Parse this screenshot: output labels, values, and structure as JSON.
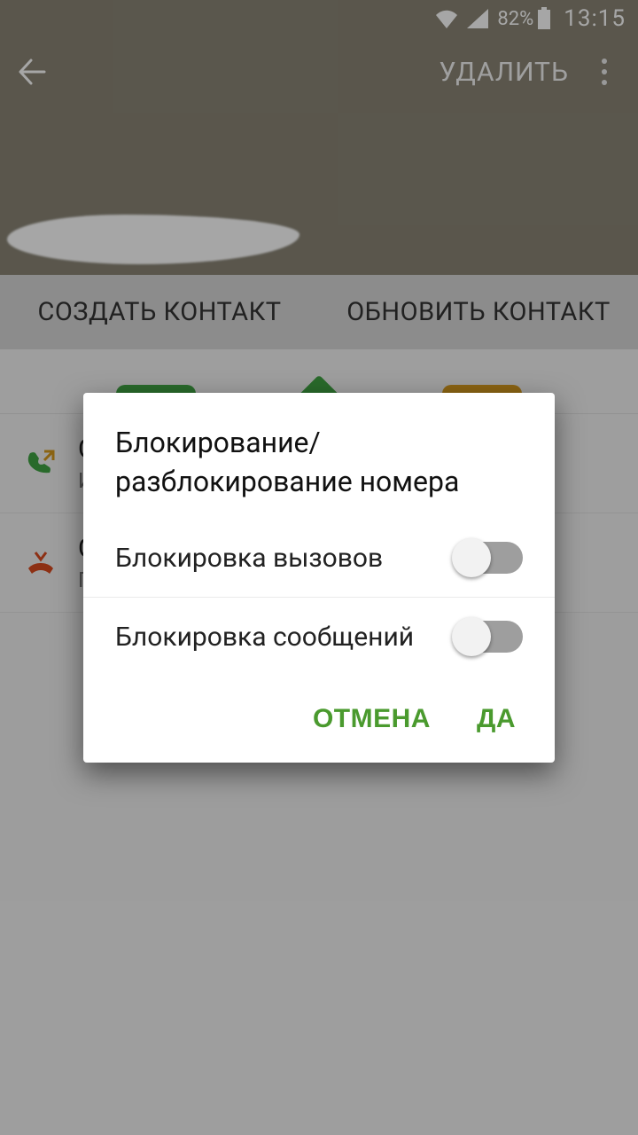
{
  "status": {
    "battery_pct": "82%",
    "time": "13:15"
  },
  "toolbar": {
    "delete_label": "УДАЛИТЬ"
  },
  "tabs": {
    "create": "СОЗДАТЬ КОНТАКТ",
    "update": "ОБНОВИТЬ КОНТАКТ"
  },
  "call_log": {
    "row1": {
      "line1": "С",
      "line2": "И"
    },
    "row2": {
      "line1": "С",
      "line2": "П"
    }
  },
  "dialog": {
    "title": "Блокирование/разблокирование номера",
    "option_calls": "Блокировка вызовов",
    "option_messages": "Блокировка сообщений",
    "cancel": "ОТМЕНА",
    "ok": "ДА",
    "calls_on": false,
    "messages_on": false
  },
  "colors": {
    "header": "#8a8576",
    "accent_green": "#4a9a2e",
    "chip_green": "#3fa343",
    "chip_orange": "#d69a1e"
  }
}
